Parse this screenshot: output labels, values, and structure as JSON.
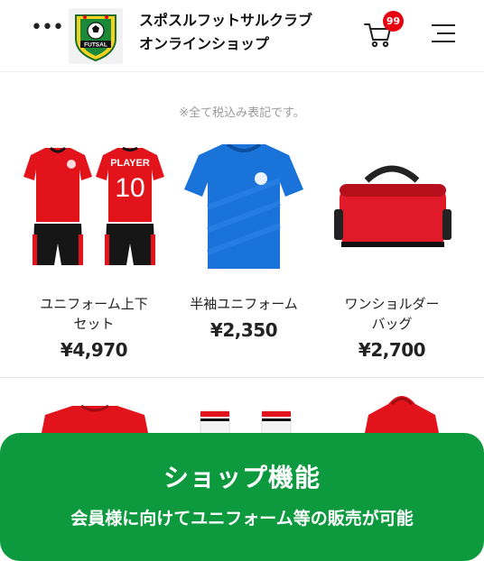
{
  "header": {
    "more_icon": "more-dots-icon",
    "logo_text": "FUTSAL",
    "shop_name_line1": "スポスルフットサルクラブ",
    "shop_name_line2": "オンラインショップ",
    "cart_icon": "cart-icon",
    "cart_count": "99",
    "menu_icon": "hamburger-menu-icon"
  },
  "tax_note": "※全て税込み表記です。",
  "products": [
    {
      "name_line1": "ユニフォーム上下",
      "name_line2": "セット",
      "price": "¥4,970",
      "jersey_text": "PLAYER",
      "jersey_number": "10"
    },
    {
      "name_line1": "半袖ユニフォーム",
      "name_line2": "",
      "price": "¥2,350"
    },
    {
      "name_line1": "ワンショルダー",
      "name_line2": "バッグ",
      "price": "¥2,700"
    }
  ],
  "colors": {
    "brand_green": "#0d9a3e",
    "badge_red": "#e60012",
    "jersey_red": "#e3131b",
    "jersey_blue": "#1a73d9"
  },
  "banner": {
    "title": "ショップ機能",
    "subtitle": "会員様に向けてユニフォーム等の販売が可能"
  }
}
